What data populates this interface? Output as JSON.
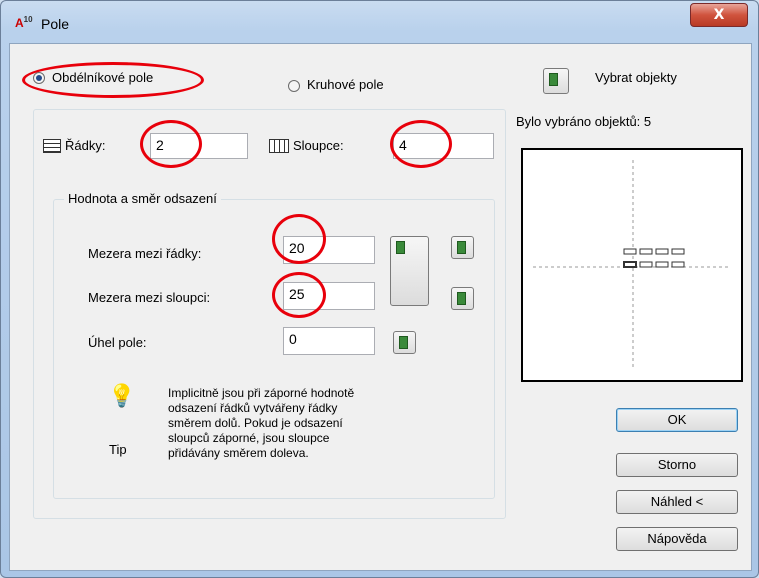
{
  "window": {
    "title": "Pole",
    "app_icon_text": "A",
    "app_icon_sup": "10",
    "close_label": "X"
  },
  "mode": {
    "rect_label": "Obdélníkové pole",
    "polar_label": "Kruhové pole",
    "selected": "rect"
  },
  "select": {
    "label": "Vybrat objekty",
    "status": "Bylo vybráno objektů: 5"
  },
  "rows": {
    "label": "Řádky:",
    "value": "2"
  },
  "cols": {
    "label": "Sloupce:",
    "value": "4"
  },
  "offset": {
    "group_title": "Hodnota a směr odsazení",
    "row_spacing_label": "Mezera mezi řádky:",
    "row_spacing_value": "20",
    "col_spacing_label": "Mezera mezi sloupci:",
    "col_spacing_value": "25",
    "angle_label": "Úhel pole:",
    "angle_value": "0"
  },
  "tip": {
    "label": "Tip",
    "lines": [
      "Implicitně jsou při záporné hodnotě",
      "odsazení řádků vytvářeny řádky",
      "směrem dolů. Pokud je odsazení",
      "sloupců záporné, jsou sloupce",
      "přidávány směrem doleva."
    ]
  },
  "buttons": {
    "ok": "OK",
    "cancel": "Storno",
    "preview": "Náhled <",
    "help": "Nápověda"
  },
  "colors": {
    "annotation": "#e8000b",
    "selected_radio": "#234a8a"
  }
}
